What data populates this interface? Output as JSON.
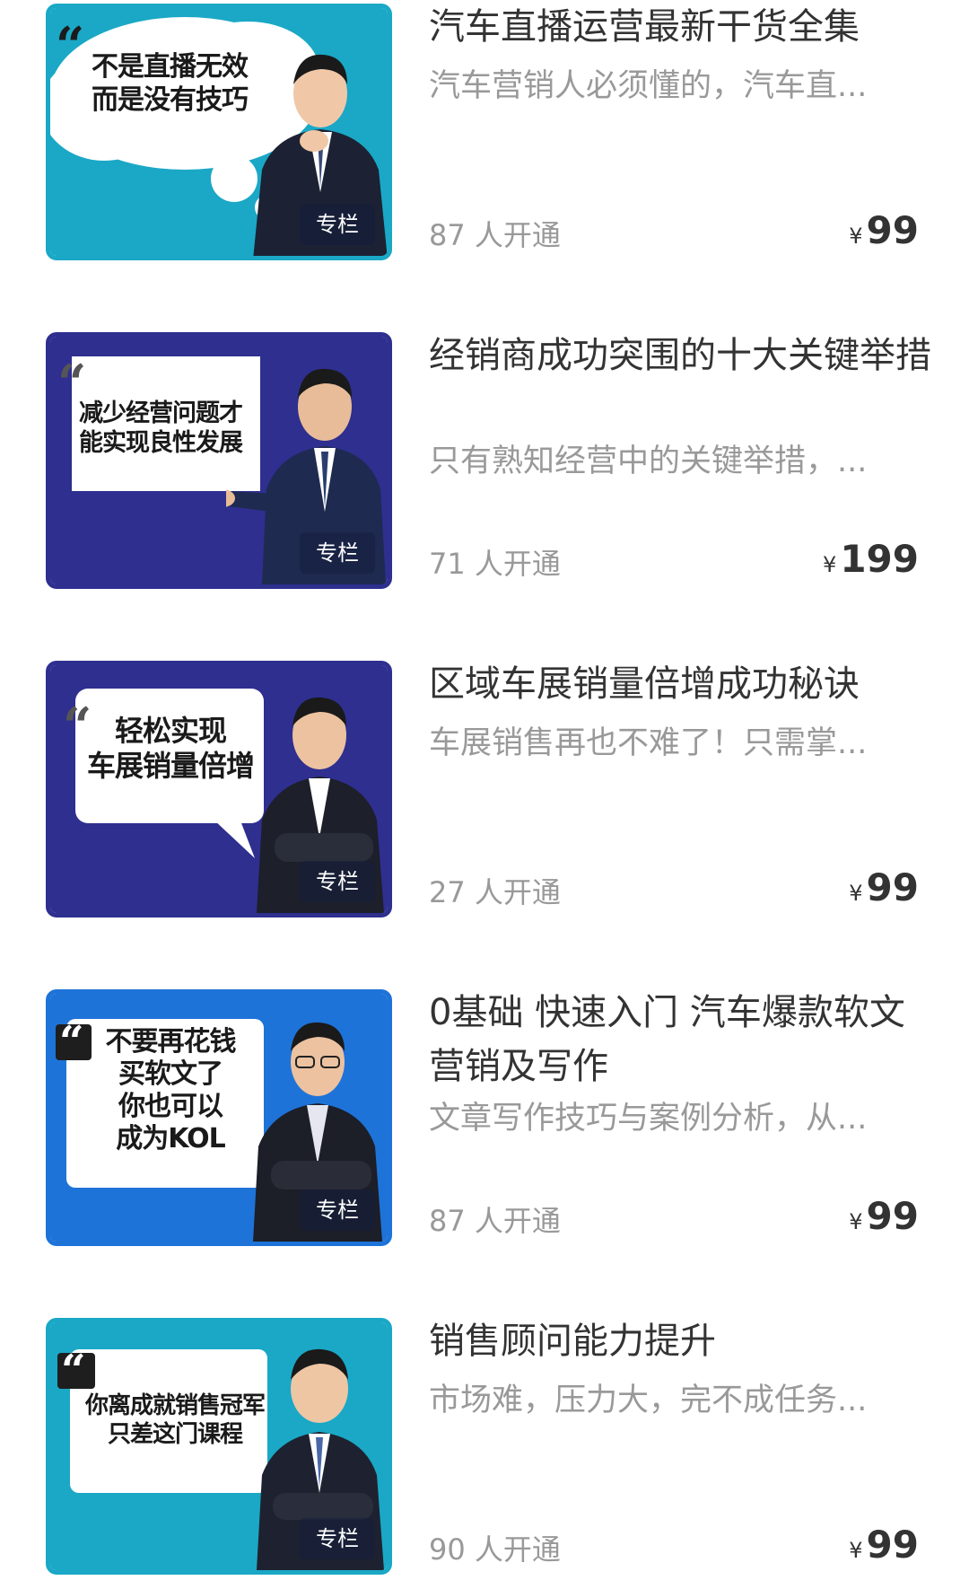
{
  "colors": {
    "title": "#333333",
    "secondary": "#999999",
    "teal": "#1aa8c6",
    "navy": "#2e2f8f",
    "blue": "#1e73d8"
  },
  "courses": [
    {
      "title": "汽车直播运营最新干货全集",
      "description": "汽车营销人必须懂的，汽车直...",
      "subscribers": "87 人开通",
      "currency": "¥",
      "price": "99",
      "thumbnail": {
        "theme": "teal",
        "slogan": "不是直播无效\n而是没有技巧",
        "quote": "“",
        "tag": "专栏",
        "icon": "person-thinking-icon"
      }
    },
    {
      "title": "经销商成功突围的十大关键举措",
      "description": "只有熟知经营中的关键举措，...",
      "subscribers": "71 人开通",
      "currency": "¥",
      "price": "199",
      "thumbnail": {
        "theme": "navy",
        "slogan": "减少经营问题才\n能实现良性发展",
        "quote": "“",
        "tag": "专栏",
        "icon": "person-pointing-icon"
      }
    },
    {
      "title": "区域车展销量倍增成功秘诀",
      "description": "车展销售再也不难了！只需掌...",
      "subscribers": "27 人开通",
      "currency": "¥",
      "price": "99",
      "thumbnail": {
        "theme": "navy",
        "slogan": "轻松实现\n车展销量倍增",
        "quote": "“",
        "tag": "专栏",
        "icon": "person-arms-crossed-icon"
      }
    },
    {
      "title": "0基础 快速入门 汽车爆款软文营销及写作",
      "description": "文章写作技巧与案例分析，从...",
      "subscribers": "87 人开通",
      "currency": "¥",
      "price": "99",
      "thumbnail": {
        "theme": "blue",
        "slogan": "不要再花钱\n买软文了\n你也可以\n成为KOL",
        "quote": "“",
        "tag": "专栏",
        "icon": "person-glasses-icon"
      }
    },
    {
      "title": "销售顾问能力提升",
      "description": "市场难，压力大，完不成任务...",
      "subscribers": "90 人开通",
      "currency": "¥",
      "price": "99",
      "thumbnail": {
        "theme": "teal",
        "slogan": "你离成就销售冠军\n只差这门课程",
        "quote": "“",
        "tag": "专栏",
        "icon": "person-smiling-icon"
      }
    }
  ]
}
